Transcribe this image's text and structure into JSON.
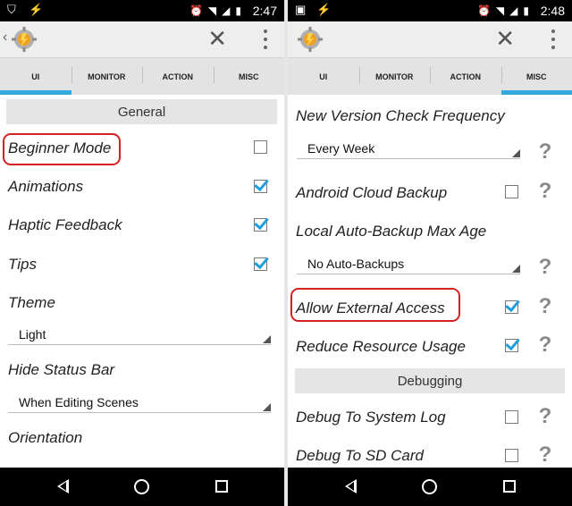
{
  "left": {
    "status": {
      "time": "2:47"
    },
    "tabs": [
      {
        "label": "UI",
        "active": true
      },
      {
        "label": "MONITOR",
        "active": false
      },
      {
        "label": "ACTION",
        "active": false
      },
      {
        "label": "MISC",
        "active": false
      }
    ],
    "general_header": "General",
    "beginner_mode": {
      "label": "Beginner Mode",
      "checked": false
    },
    "animations": {
      "label": "Animations",
      "checked": true
    },
    "haptic_feedback": {
      "label": "Haptic Feedback",
      "checked": true
    },
    "tips": {
      "label": "Tips",
      "checked": true
    },
    "theme": {
      "label": "Theme",
      "value": "Light"
    },
    "hide_status_bar": {
      "label": "Hide Status Bar",
      "value": "When Editing Scenes"
    },
    "orientation": {
      "label": "Orientation"
    }
  },
  "right": {
    "status": {
      "time": "2:48"
    },
    "tabs": [
      {
        "label": "UI",
        "active": false
      },
      {
        "label": "MONITOR",
        "active": false
      },
      {
        "label": "ACTION",
        "active": false
      },
      {
        "label": "MISC",
        "active": true
      }
    ],
    "new_version": {
      "label": "New Version Check Frequency",
      "value": "Every Week"
    },
    "cloud_backup": {
      "label": "Android Cloud Backup",
      "checked": false
    },
    "auto_backup": {
      "label": "Local Auto-Backup Max Age",
      "value": "No Auto-Backups"
    },
    "external_access": {
      "label": "Allow External Access",
      "checked": true
    },
    "reduce_resource": {
      "label": "Reduce Resource Usage",
      "checked": true
    },
    "debugging_header": "Debugging",
    "debug_system_log": {
      "label": "Debug To System Log",
      "checked": false
    },
    "debug_sd_card": {
      "label": "Debug To SD Card",
      "checked": false
    },
    "help_glyph": "?"
  },
  "icons": {
    "status_left": [
      "shield-icon",
      "flash-icon",
      "image-icon"
    ],
    "status_right": [
      "alarm-icon",
      "wifi-icon",
      "signal-icon",
      "battery-icon"
    ],
    "actionbar": [
      "app-logo-icon",
      "close-icon",
      "overflow-menu-icon"
    ],
    "navbar": [
      "nav-back-icon",
      "nav-home-icon",
      "nav-recents-icon"
    ]
  },
  "colors": {
    "accent": "#33aadd",
    "check": "#1f9fda",
    "highlight": "#d22222"
  }
}
